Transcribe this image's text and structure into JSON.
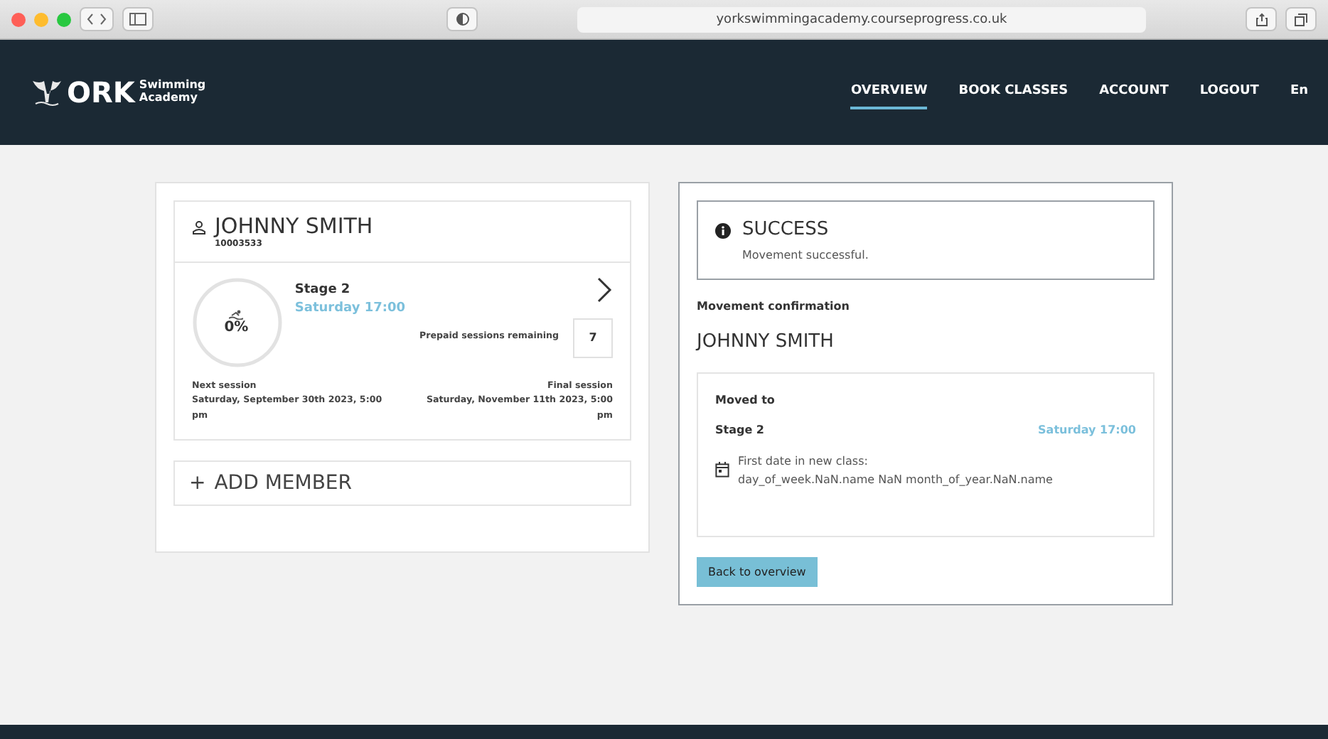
{
  "browser": {
    "url": "yorkswimmingacademy.courseprogress.co.uk"
  },
  "logo": {
    "mark": "ORK",
    "line1": "Swimming",
    "line2": "Academy"
  },
  "nav": [
    {
      "label": "OVERVIEW",
      "selected": true
    },
    {
      "label": "BOOK CLASSES",
      "selected": false
    },
    {
      "label": "ACCOUNT",
      "selected": false
    },
    {
      "label": "LOGOUT",
      "selected": false
    },
    {
      "label": "En",
      "selected": false
    }
  ],
  "member": {
    "name": "JOHNNY SMITH",
    "id": "10003533",
    "progress": {
      "reading": "0%",
      "level": 0
    },
    "stage": "Stage 2",
    "time": "Saturday 17:00",
    "prepaid_label": "Prepaid sessions remaining",
    "prepaid": "7",
    "next_label": "Next session",
    "next": "Saturday, September 30th 2023, 5:00 pm",
    "final_label": "Final session",
    "final": "Saturday, November 11th 2023, 5:00 pm"
  },
  "add_member": {
    "icon": "+",
    "label": "ADD MEMBER"
  },
  "alert": {
    "title": "SUCCESS",
    "message": "Movement successful."
  },
  "confirmation": {
    "heading": "Movement confirmation",
    "name": "JOHNNY SMITH",
    "moved_label": "Moved to",
    "stage": "Stage 2",
    "time": "Saturday 17:00",
    "first_label": "First date in new class:",
    "first_value": "day_of_week.NaN.name NaN month_of_year.NaN.name"
  },
  "back_button": "Back to overview"
}
